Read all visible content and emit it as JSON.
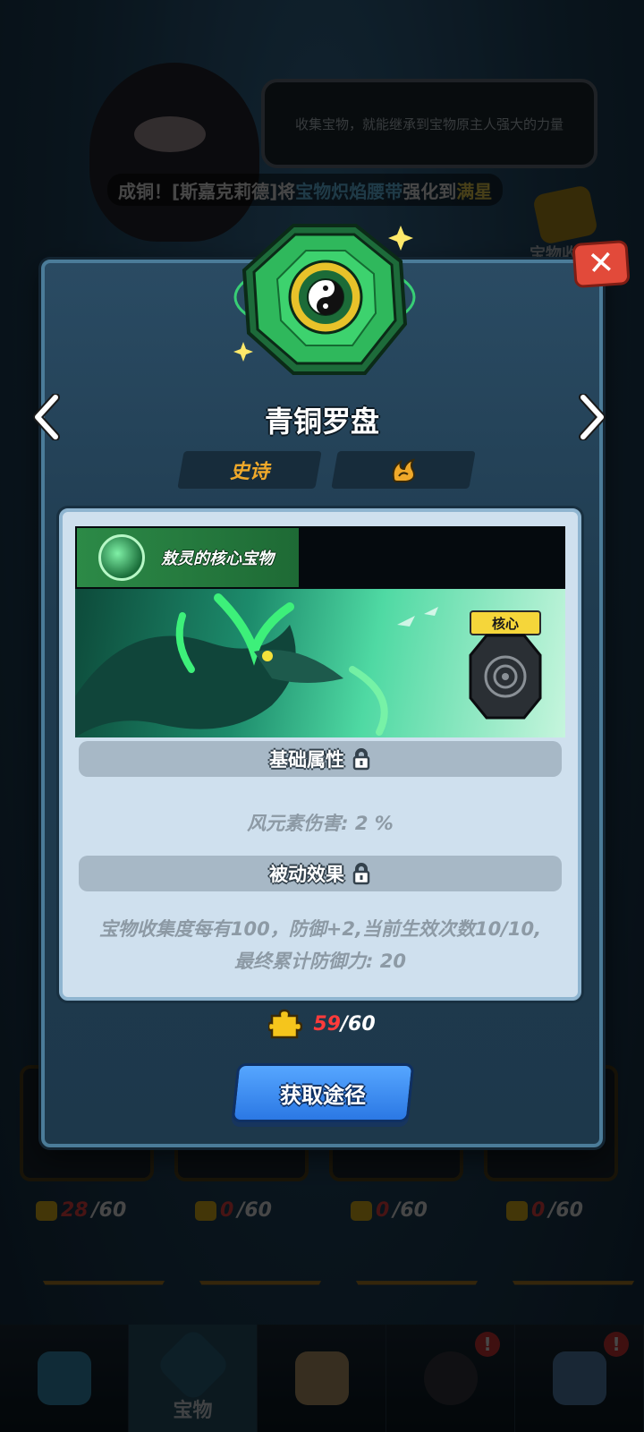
{
  "background": {
    "tip_text": "收集宝物，就能继承到宝物原主人强大的力量",
    "ticker": {
      "prefix": "成铜！[斯嘉克莉德]将",
      "item": "宝物炽焰腰带",
      "mid": "强化到",
      "level": "满星"
    },
    "chest_label": "宝物收",
    "grid_counts": [
      {
        "current": "28",
        "total": "/60"
      },
      {
        "current": "0",
        "total": "/60"
      },
      {
        "current": "0",
        "total": "/60"
      },
      {
        "current": "0",
        "total": "/60"
      }
    ],
    "nav": [
      {
        "label": "",
        "icon": "crystal-icon",
        "badge": ""
      },
      {
        "label": "宝物",
        "icon": "treasure-icon",
        "badge": ""
      },
      {
        "label": "",
        "icon": "map-icon",
        "badge": ""
      },
      {
        "label": "",
        "icon": "character-icon",
        "badge": "!"
      },
      {
        "label": "",
        "icon": "chest-icon",
        "badge": "!"
      }
    ]
  },
  "modal": {
    "title": "青铜罗盘",
    "rarity": "史诗",
    "element_icon": "wind-element-icon",
    "owner_label": "敖灵的核心宝物",
    "core_badge": "核心",
    "base_section": "基础属性",
    "base_stat": "风元素伤害: 2 %",
    "passive_section": "被动效果",
    "passive_line1": "宝物收集度每有100，防御+2,当前生效次数10/10,",
    "passive_line2": "最终累计防御力: 20",
    "shards_current": "59",
    "shards_total": "/60",
    "obtain_button": "获取途径",
    "close_label": "✕"
  },
  "colors": {
    "rarity": "#f0a92a",
    "accent_green": "#2ee36f",
    "button_blue": "#3a8cf0",
    "close_red": "#e24a3a"
  }
}
